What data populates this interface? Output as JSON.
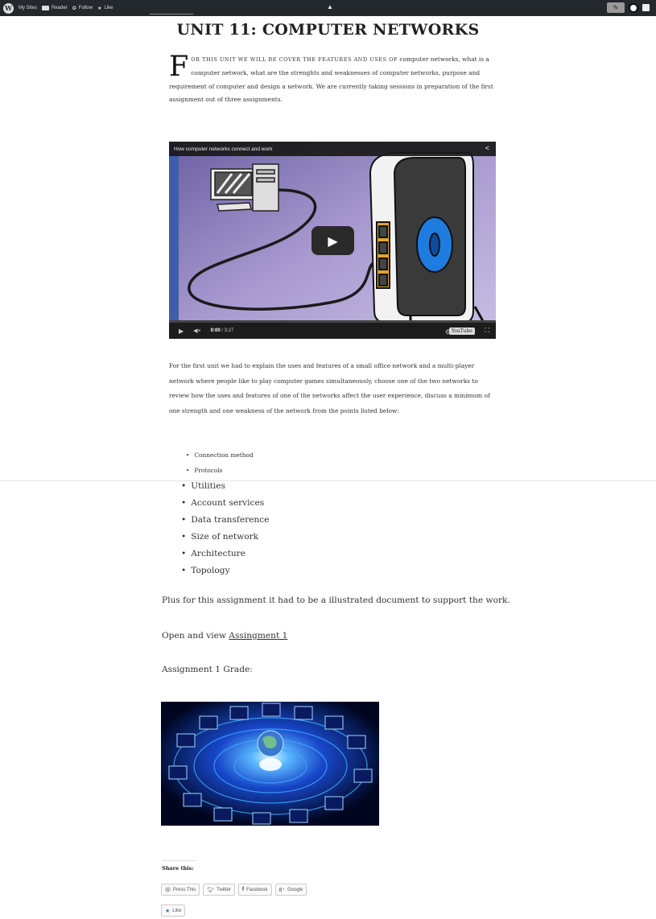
{
  "admin_bar": {
    "my_sites": "My Sites",
    "reader": "Reader",
    "follow": "Follow",
    "like": "Like",
    "icons": [
      "wordpress-logo-icon",
      "reader-icon",
      "follow-icon",
      "star-icon",
      "write-icon",
      "avatar-icon",
      "notifications-icon"
    ]
  },
  "post": {
    "title": "UNIT 11: COMPUTER NETWORKS",
    "intro": {
      "dropcap": "F",
      "caps": "or this unit we will be cover the features and uses of",
      "rest": "computer networks, what is a computer network, what are the strenghts and weaknesses of computer networks, purpose and requirement of computer and design a network. We are currently taking sessions in preparation of the first assignment out of three assignments."
    },
    "video": {
      "title": "How computer networks connect and work",
      "time_current": "0:00",
      "time_total": "/ 3:27",
      "progress": 0,
      "youtube_label": "YouTube"
    },
    "paragraph2": "For the first unit we had to explain the uses and features of a small office network and a multi-player network where people like to play computer games simultaneously, choose one of the two networks to review how the uses and features of one of the networks affect the user experience, discuss a minimum of one strength and one weakness of the network from the points listed below:",
    "list_small": [
      "Connection method",
      "Protocols"
    ],
    "list_big": [
      "Utilities",
      "Account services",
      "Data transference",
      "Size of network",
      "Architecture",
      "Topology"
    ],
    "plus_text": "Plus for this assignment it had to be a illustrated document to support the work.",
    "open_prefix": "Open and view ",
    "open_link": "Assingment 1",
    "grade_text": "Assignment 1 Grade:"
  },
  "share": {
    "heading": "Share this:",
    "buttons": [
      "Press This",
      "Twitter",
      "Facebook",
      "Google"
    ],
    "like": "Like"
  },
  "colors": {
    "admin_bar": "#23282d",
    "video_bg": "#7a6fa7",
    "globe_glow": "#2a7bff"
  }
}
